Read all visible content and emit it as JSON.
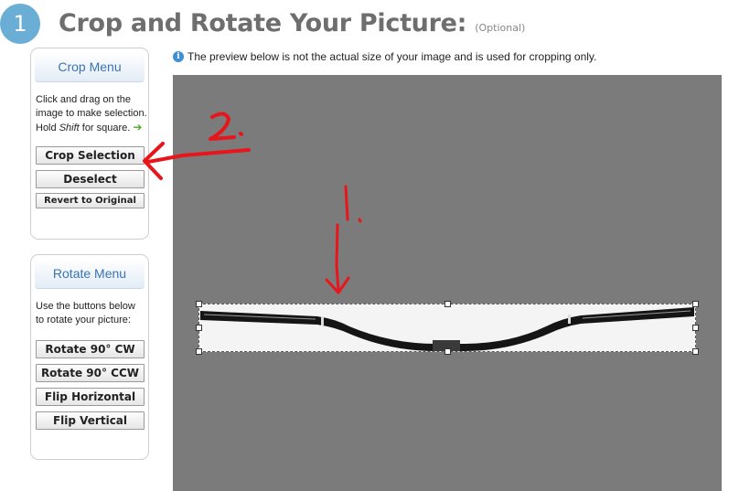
{
  "header": {
    "step_number": "1",
    "title": "Crop and Rotate Your Picture:",
    "optional": "(Optional)"
  },
  "crop_menu": {
    "title": "Crop Menu",
    "instructions_1": "Click and drag on the image to make selection. Hold ",
    "instructions_shift": "Shift",
    "instructions_2": " for square.",
    "buttons": {
      "crop_selection": "Crop Selection",
      "deselect": "Deselect",
      "revert": "Revert to Original"
    }
  },
  "rotate_menu": {
    "title": "Rotate Menu",
    "instructions": "Use the buttons below to rotate your picture:",
    "buttons": {
      "rotate_cw": "Rotate 90° CW",
      "rotate_ccw": "Rotate 90° CCW",
      "flip_horizontal": "Flip Horizontal",
      "flip_vertical": "Flip Vertical"
    }
  },
  "info": {
    "icon": "info-icon",
    "text": "The preview below is not the actual size of your image and is used for cropping only."
  },
  "annotations": {
    "label_1": "1.",
    "label_2": "2."
  },
  "colors": {
    "accent": "#3c74b0",
    "step_circle": "#6aaed6",
    "preview_bg": "#7b7b7b",
    "annotation": "#e8151b"
  }
}
